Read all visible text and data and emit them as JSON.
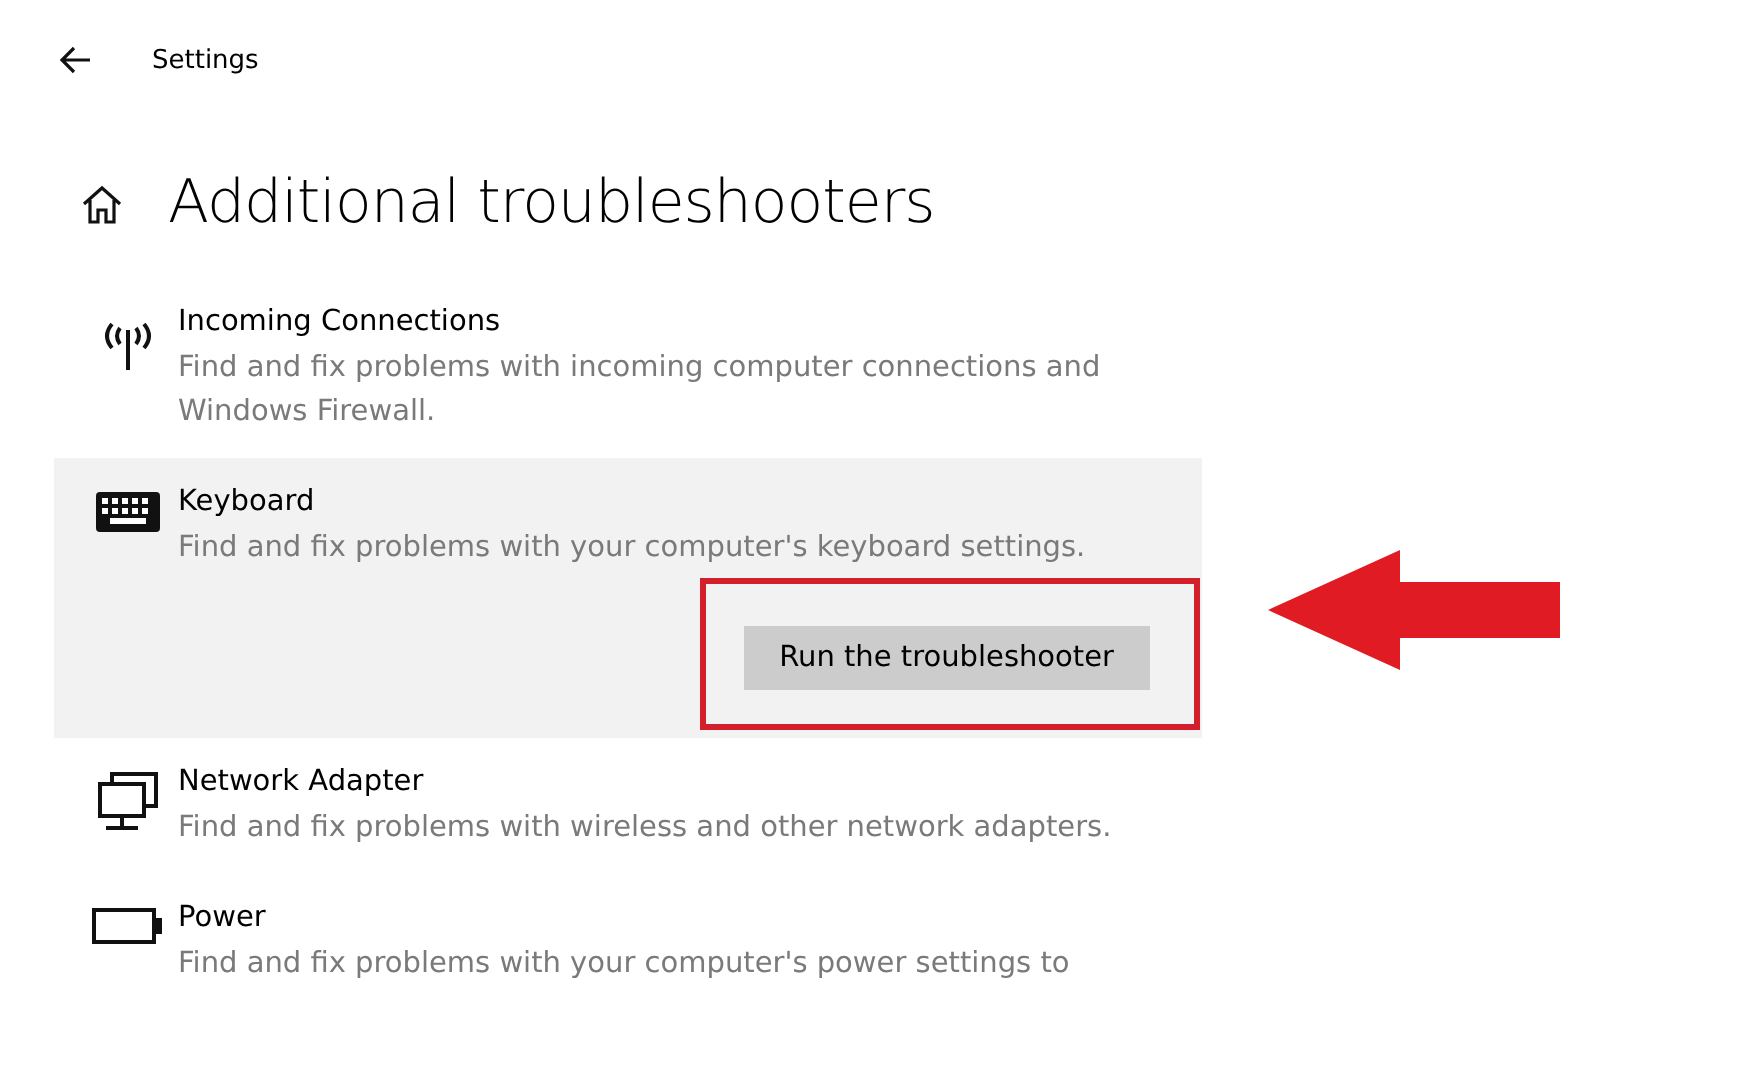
{
  "window": {
    "title": "Settings"
  },
  "page": {
    "title": "Additional troubleshooters"
  },
  "troubleshooters": [
    {
      "name": "Incoming Connections",
      "description": "Find and fix problems with incoming computer connections and Windows Firewall.",
      "expanded": false,
      "highlighted": false
    },
    {
      "name": "Keyboard",
      "description": "Find and fix problems with your computer's keyboard settings.",
      "expanded": true,
      "highlighted": true,
      "button": "Run the troubleshooter"
    },
    {
      "name": "Network Adapter",
      "description": "Find and fix problems with wireless and other network adapters.",
      "expanded": false,
      "highlighted": false
    },
    {
      "name": "Power",
      "description": "Find and fix problems with your computer's power settings to",
      "expanded": false,
      "highlighted": false
    }
  ]
}
